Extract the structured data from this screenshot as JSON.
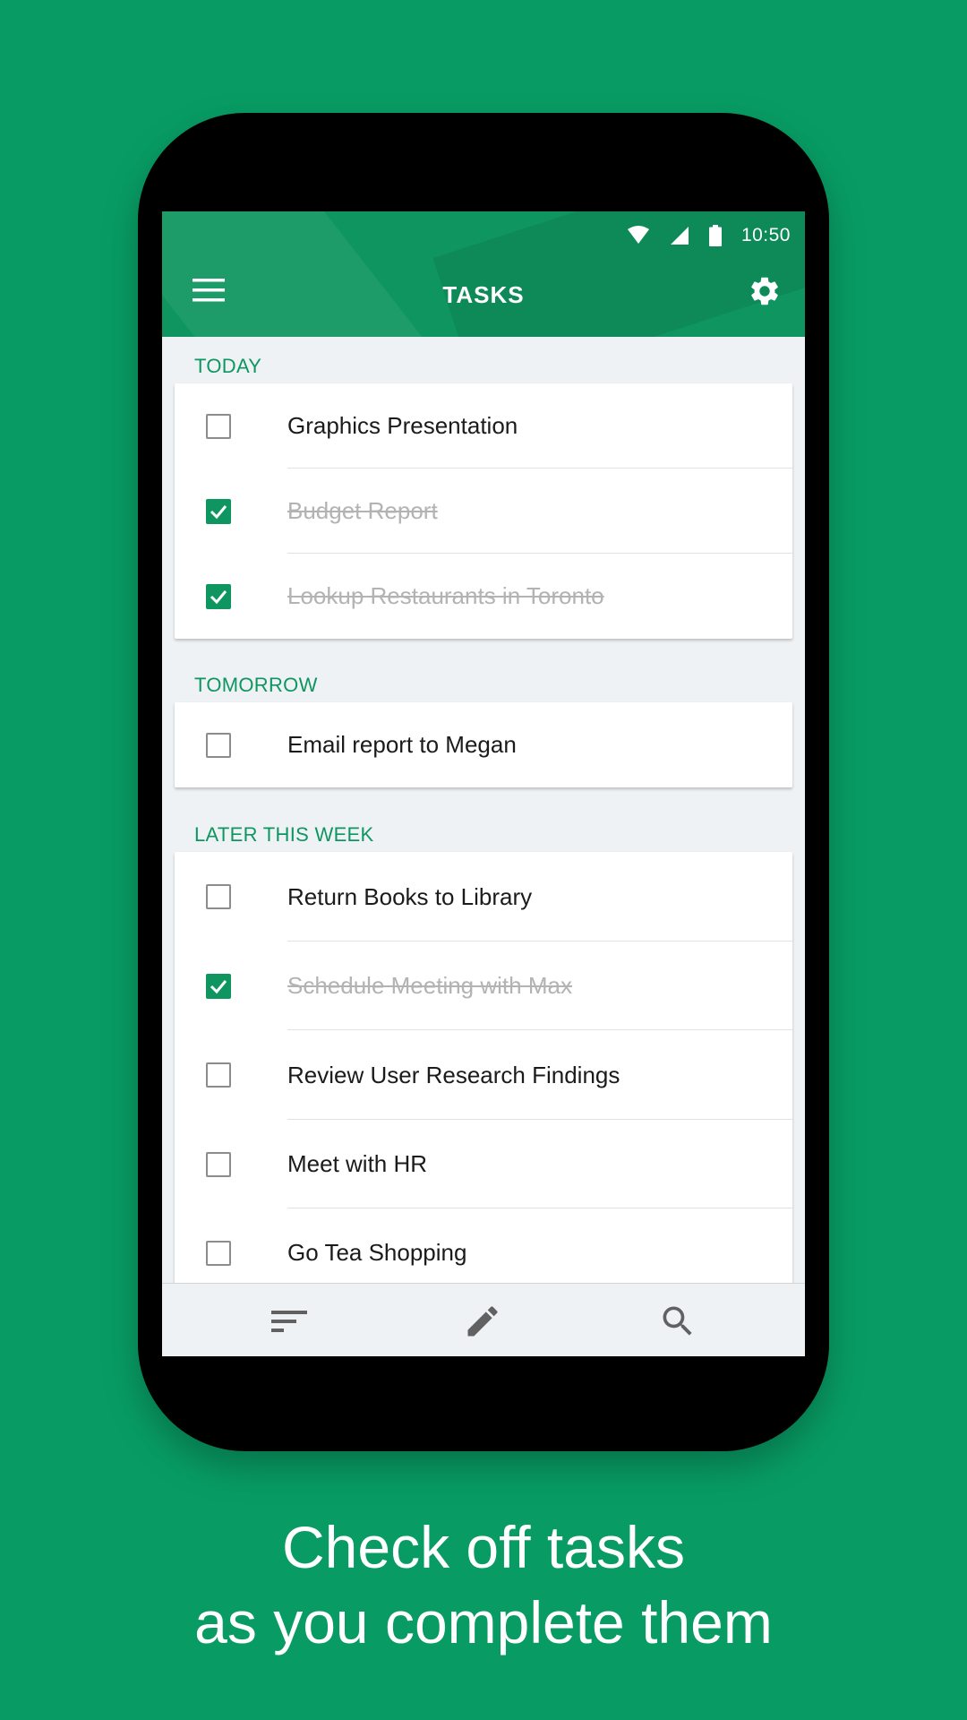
{
  "status_bar": {
    "time": "10:50"
  },
  "toolbar": {
    "title": "TASKS",
    "menu_icon": "menu-icon",
    "settings_icon": "gear-icon"
  },
  "sections": [
    {
      "label": "TODAY",
      "tasks": [
        {
          "label": "Graphics Presentation",
          "done": false
        },
        {
          "label": "Budget Report",
          "done": true
        },
        {
          "label": "Lookup Restaurants in Toronto",
          "done": true
        }
      ]
    },
    {
      "label": "TOMORROW",
      "tasks": [
        {
          "label": "Email report to Megan",
          "done": false
        }
      ]
    },
    {
      "label": "LATER THIS WEEK",
      "tasks": [
        {
          "label": "Return Books to Library",
          "done": false
        },
        {
          "label": "Schedule Meeting with Max",
          "done": true
        },
        {
          "label": "Review User Research Findings",
          "done": false
        },
        {
          "label": "Meet with HR",
          "done": false
        },
        {
          "label": "Go Tea Shopping",
          "done": false
        }
      ]
    }
  ],
  "bottom_bar": {
    "icons": [
      "sort-icon",
      "edit-icon",
      "search-icon"
    ]
  },
  "caption": {
    "line1": "Check off tasks",
    "line2": "as you complete them"
  },
  "colors": {
    "background": "#089c64",
    "accent": "#0f9660"
  }
}
